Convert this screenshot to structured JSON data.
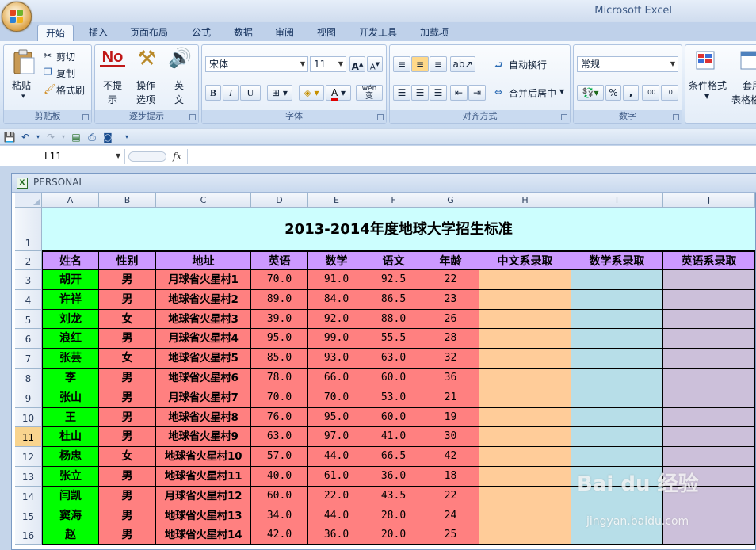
{
  "app": {
    "title": "Microsoft Excel"
  },
  "tabs": [
    "开始",
    "插入",
    "页面布局",
    "公式",
    "数据",
    "审阅",
    "视图",
    "开发工具",
    "加载项"
  ],
  "ribbon": {
    "clipboard": {
      "paste": "粘贴",
      "cut": "剪切",
      "copy": "复制",
      "format_painter": "格式刷",
      "label": "剪贴板"
    },
    "step_tips": {
      "no_icon_text": "No",
      "no_tips": [
        "不提",
        "示"
      ],
      "op_tips": [
        "操作",
        "选项"
      ],
      "english": [
        "英",
        "文"
      ],
      "label": "逐步提示"
    },
    "font": {
      "name": "宋体",
      "size": "11",
      "bold": "B",
      "italic": "I",
      "underline": "U",
      "font_color_glyph": "A",
      "phonetic_top": "wén",
      "phonetic_bottom": "变",
      "label": "字体"
    },
    "alignment": {
      "wrap": "自动换行",
      "merge": "合并后居中",
      "label": "对齐方式"
    },
    "number": {
      "format": "常规",
      "percent": "%",
      "comma": ",",
      "label": "数字"
    },
    "styles": {
      "conditional": "条件格式",
      "table_lines": [
        "套用",
        "表格格"
      ]
    }
  },
  "formula_bar": {
    "name_box": "L11",
    "fx": "fx",
    "value": ""
  },
  "workbook": {
    "name": "PERSONAL"
  },
  "sheet": {
    "columns": [
      "A",
      "B",
      "C",
      "D",
      "E",
      "F",
      "G",
      "H",
      "I",
      "J"
    ],
    "row_numbers": [
      "1",
      "2",
      "3",
      "4",
      "5",
      "6",
      "7",
      "8",
      "9",
      "10",
      "11",
      "12",
      "13",
      "14",
      "15",
      "16"
    ],
    "title": "2013-2014年度地球大学招生标准",
    "headers": [
      "姓名",
      "性别",
      "地址",
      "英语",
      "数学",
      "语文",
      "年龄",
      "中文系录取",
      "数学系录取",
      "英语系录取"
    ],
    "rows": [
      [
        "胡开",
        "男",
        "月球省火星村1",
        "70.0",
        "91.0",
        "92.5",
        "22"
      ],
      [
        "许祥",
        "男",
        "地球省火星村2",
        "89.0",
        "84.0",
        "86.5",
        "23"
      ],
      [
        "刘龙",
        "女",
        "地球省火星村3",
        "39.0",
        "92.0",
        "88.0",
        "26"
      ],
      [
        "浪红",
        "男",
        "月球省火星村4",
        "95.0",
        "99.0",
        "55.5",
        "28"
      ],
      [
        "张芸",
        "女",
        "地球省火星村5",
        "85.0",
        "93.0",
        "63.0",
        "32"
      ],
      [
        "李",
        "男",
        "地球省火星村6",
        "78.0",
        "66.0",
        "60.0",
        "36"
      ],
      [
        "张山",
        "男",
        "月球省火星村7",
        "70.0",
        "70.0",
        "53.0",
        "21"
      ],
      [
        "王",
        "男",
        "地球省火星村8",
        "76.0",
        "95.0",
        "60.0",
        "19"
      ],
      [
        "杜山",
        "男",
        "地球省火星村9",
        "63.0",
        "97.0",
        "41.0",
        "30"
      ],
      [
        "杨忠",
        "女",
        "地球省火星村10",
        "57.0",
        "44.0",
        "66.5",
        "42"
      ],
      [
        "张立",
        "男",
        "地球省火星村11",
        "40.0",
        "61.0",
        "36.0",
        "18"
      ],
      [
        "闫凯",
        "男",
        "月球省火星村12",
        "60.0",
        "22.0",
        "43.5",
        "22"
      ],
      [
        "窦海",
        "男",
        "地球省火星村13",
        "34.0",
        "44.0",
        "28.0",
        "24"
      ],
      [
        "赵",
        "男",
        "地球省火星村14",
        "42.0",
        "36.0",
        "20.0",
        "25"
      ]
    ],
    "selected_row": "11"
  },
  "watermark": {
    "brand": "Bai du 经验",
    "url": "jingyan.baidu.com"
  },
  "colors": {
    "title_fill": "#ccfefe",
    "header_fill": "#cc99ff",
    "name_fill": "#00ff00",
    "data_fill": "#ff8080",
    "chinese_col": "#ffcc99",
    "math_col": "#b7dee8",
    "english_col": "#ccc0da"
  }
}
